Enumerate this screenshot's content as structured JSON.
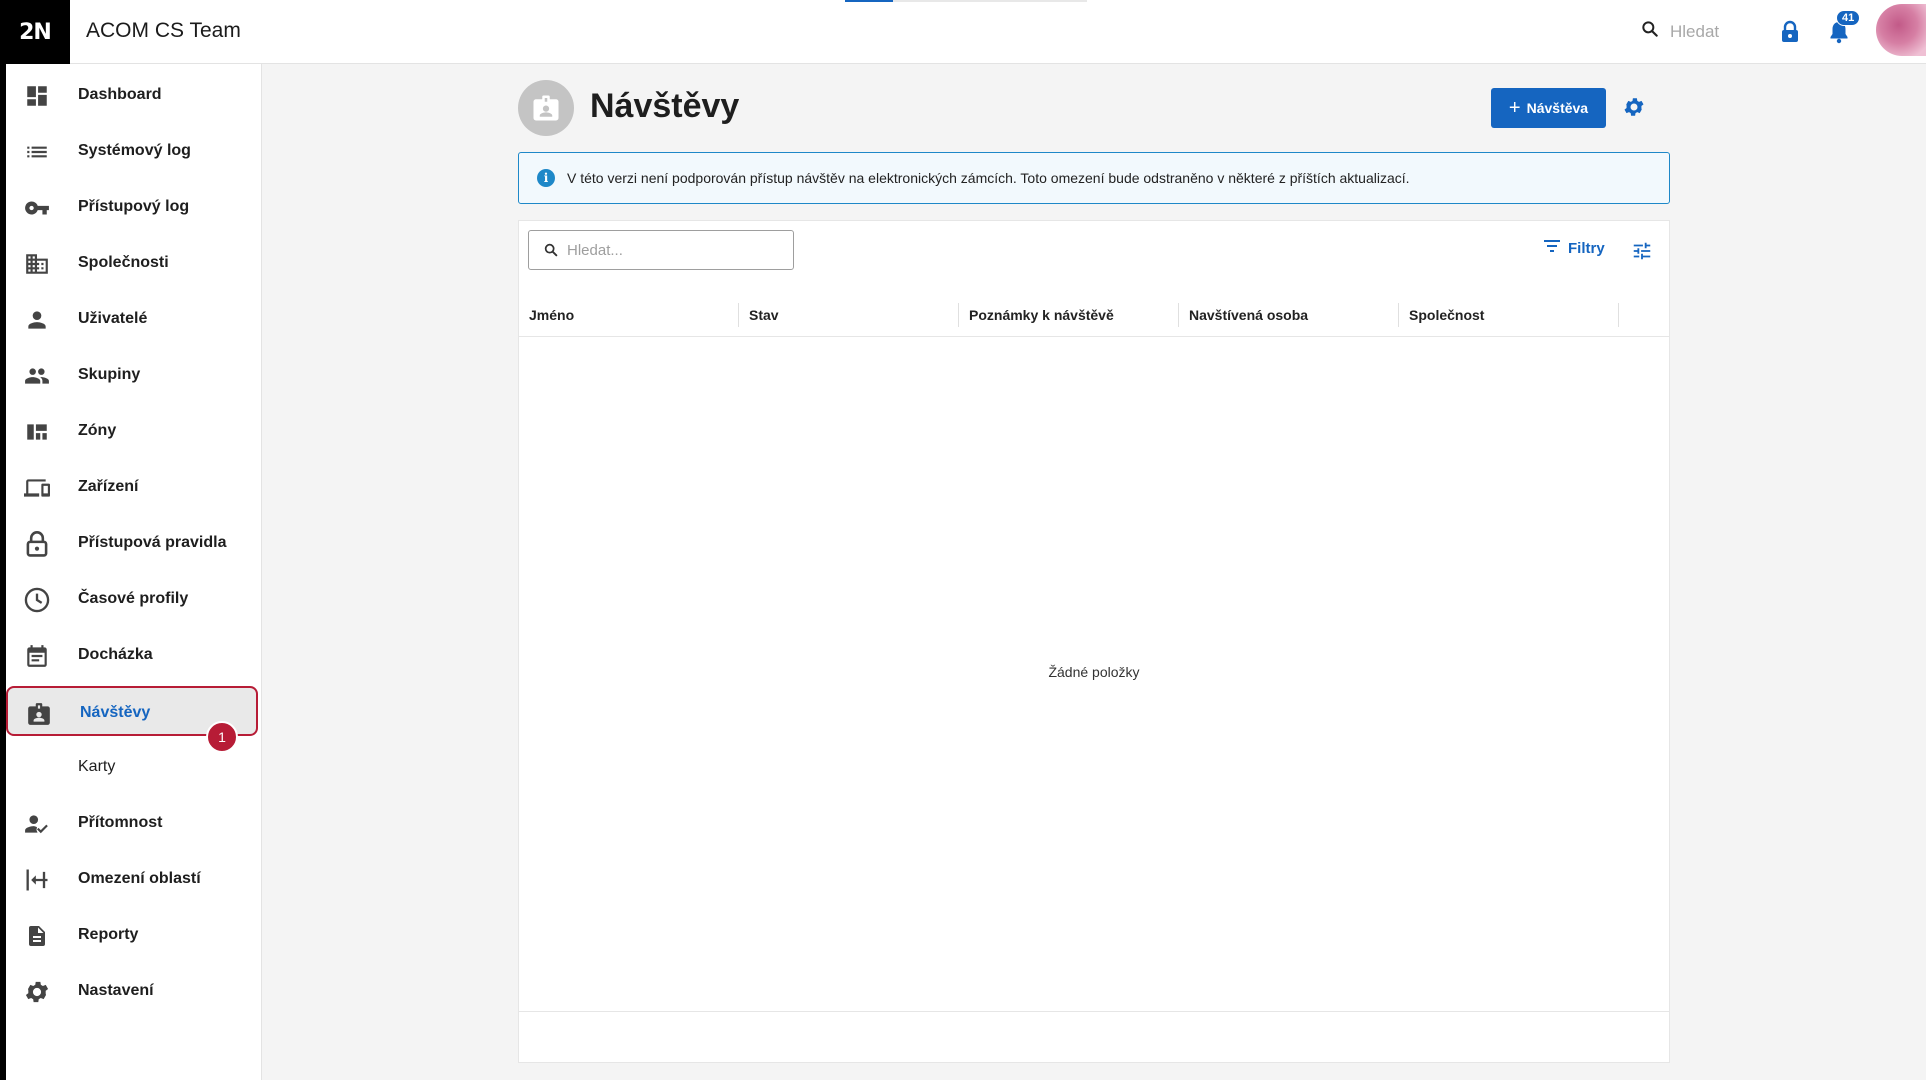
{
  "app": {
    "logo": "2N",
    "title": "ACOM CS Team"
  },
  "topbar": {
    "search_placeholder": "Hledat",
    "notifications_count": "41",
    "icons": [
      "search-icon",
      "lock-icon",
      "bell-icon"
    ]
  },
  "sidebar": {
    "items": [
      {
        "label": "Dashboard",
        "icon": "dashboard-icon"
      },
      {
        "label": "Systémový log",
        "icon": "list-icon"
      },
      {
        "label": "Přístupový log",
        "icon": "key-icon"
      },
      {
        "label": "Společnosti",
        "icon": "building-icon"
      },
      {
        "label": "Uživatelé",
        "icon": "person-icon"
      },
      {
        "label": "Skupiny",
        "icon": "group-icon"
      },
      {
        "label": "Zóny",
        "icon": "zones-icon"
      },
      {
        "label": "Zařízení",
        "icon": "devices-icon"
      },
      {
        "label": "Přístupová pravidla",
        "icon": "lock-open-icon"
      },
      {
        "label": "Časové profily",
        "icon": "clock-icon"
      },
      {
        "label": "Docházka",
        "icon": "calendar-icon"
      },
      {
        "label": "Návštěvy",
        "icon": "visitor-badge-icon",
        "active": true
      },
      {
        "label": "Karty",
        "icon": "",
        "sub": true
      },
      {
        "label": "Přítomnost",
        "icon": "person-check-icon"
      },
      {
        "label": "Omezení oblastí",
        "icon": "area-restriction-icon"
      },
      {
        "label": "Reporty",
        "icon": "report-icon"
      },
      {
        "label": "Nastavení",
        "icon": "settings-icon"
      }
    ],
    "step_badge": "1"
  },
  "page": {
    "title": "Návštěvy",
    "add_button_label": "Návštěva",
    "alert_text": "V této verzi není podporován přístup návštěv na elektronických zámcích. Toto omezení bude odstraněno v některé z příštích aktualizací."
  },
  "table": {
    "search_placeholder": "Hledat...",
    "filters_label": "Filtry",
    "columns": [
      "Jméno",
      "Stav",
      "Poznámky k návštěvě",
      "Navštívená osoba",
      "Společnost"
    ],
    "empty_text": "Žádné položky"
  },
  "colors": {
    "accent": "#1565c0",
    "highlight": "#b71c36",
    "info": "#1e88c8"
  }
}
